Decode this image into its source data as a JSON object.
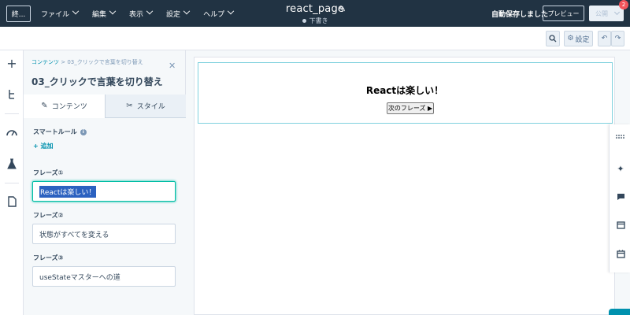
{
  "topbar": {
    "exit_label": "終...",
    "menu": [
      {
        "label": "ファイル"
      },
      {
        "label": "編集"
      },
      {
        "label": "表示"
      },
      {
        "label": "設定"
      },
      {
        "label": "ヘルプ"
      }
    ],
    "page_title": "react_page",
    "draft_status": "下書き",
    "autosave": "自動保存しました",
    "preview": "プレビュー",
    "publish": "公開",
    "badge_count": "2"
  },
  "secondary": {
    "settings_label": "設定"
  },
  "panel": {
    "breadcrumb_root": "コンテンツ",
    "breadcrumb_sep": ">",
    "breadcrumb_current": "03_クリックで言葉を切り替え",
    "title": "03_クリックで言葉を切り替え",
    "tabs": [
      {
        "label": "コンテンツ"
      },
      {
        "label": "スタイル"
      }
    ],
    "smart_rule_label": "スマートルール",
    "add_label": "+ 追加",
    "fields": [
      {
        "label": "フレーズ①",
        "value": "Reactは楽しい！"
      },
      {
        "label": "フレーズ②",
        "value": "状態がすべてを変える"
      },
      {
        "label": "フレーズ③",
        "value": "useStateマスターへの道"
      }
    ]
  },
  "canvas": {
    "phrase_text": "Reactは楽しい！",
    "next_button": "次のフレーズ ▶"
  },
  "colors": {
    "topbar_bg": "#213343",
    "accent_teal": "#00bda5",
    "link": "#0091ae",
    "badge": "#f2545b"
  }
}
